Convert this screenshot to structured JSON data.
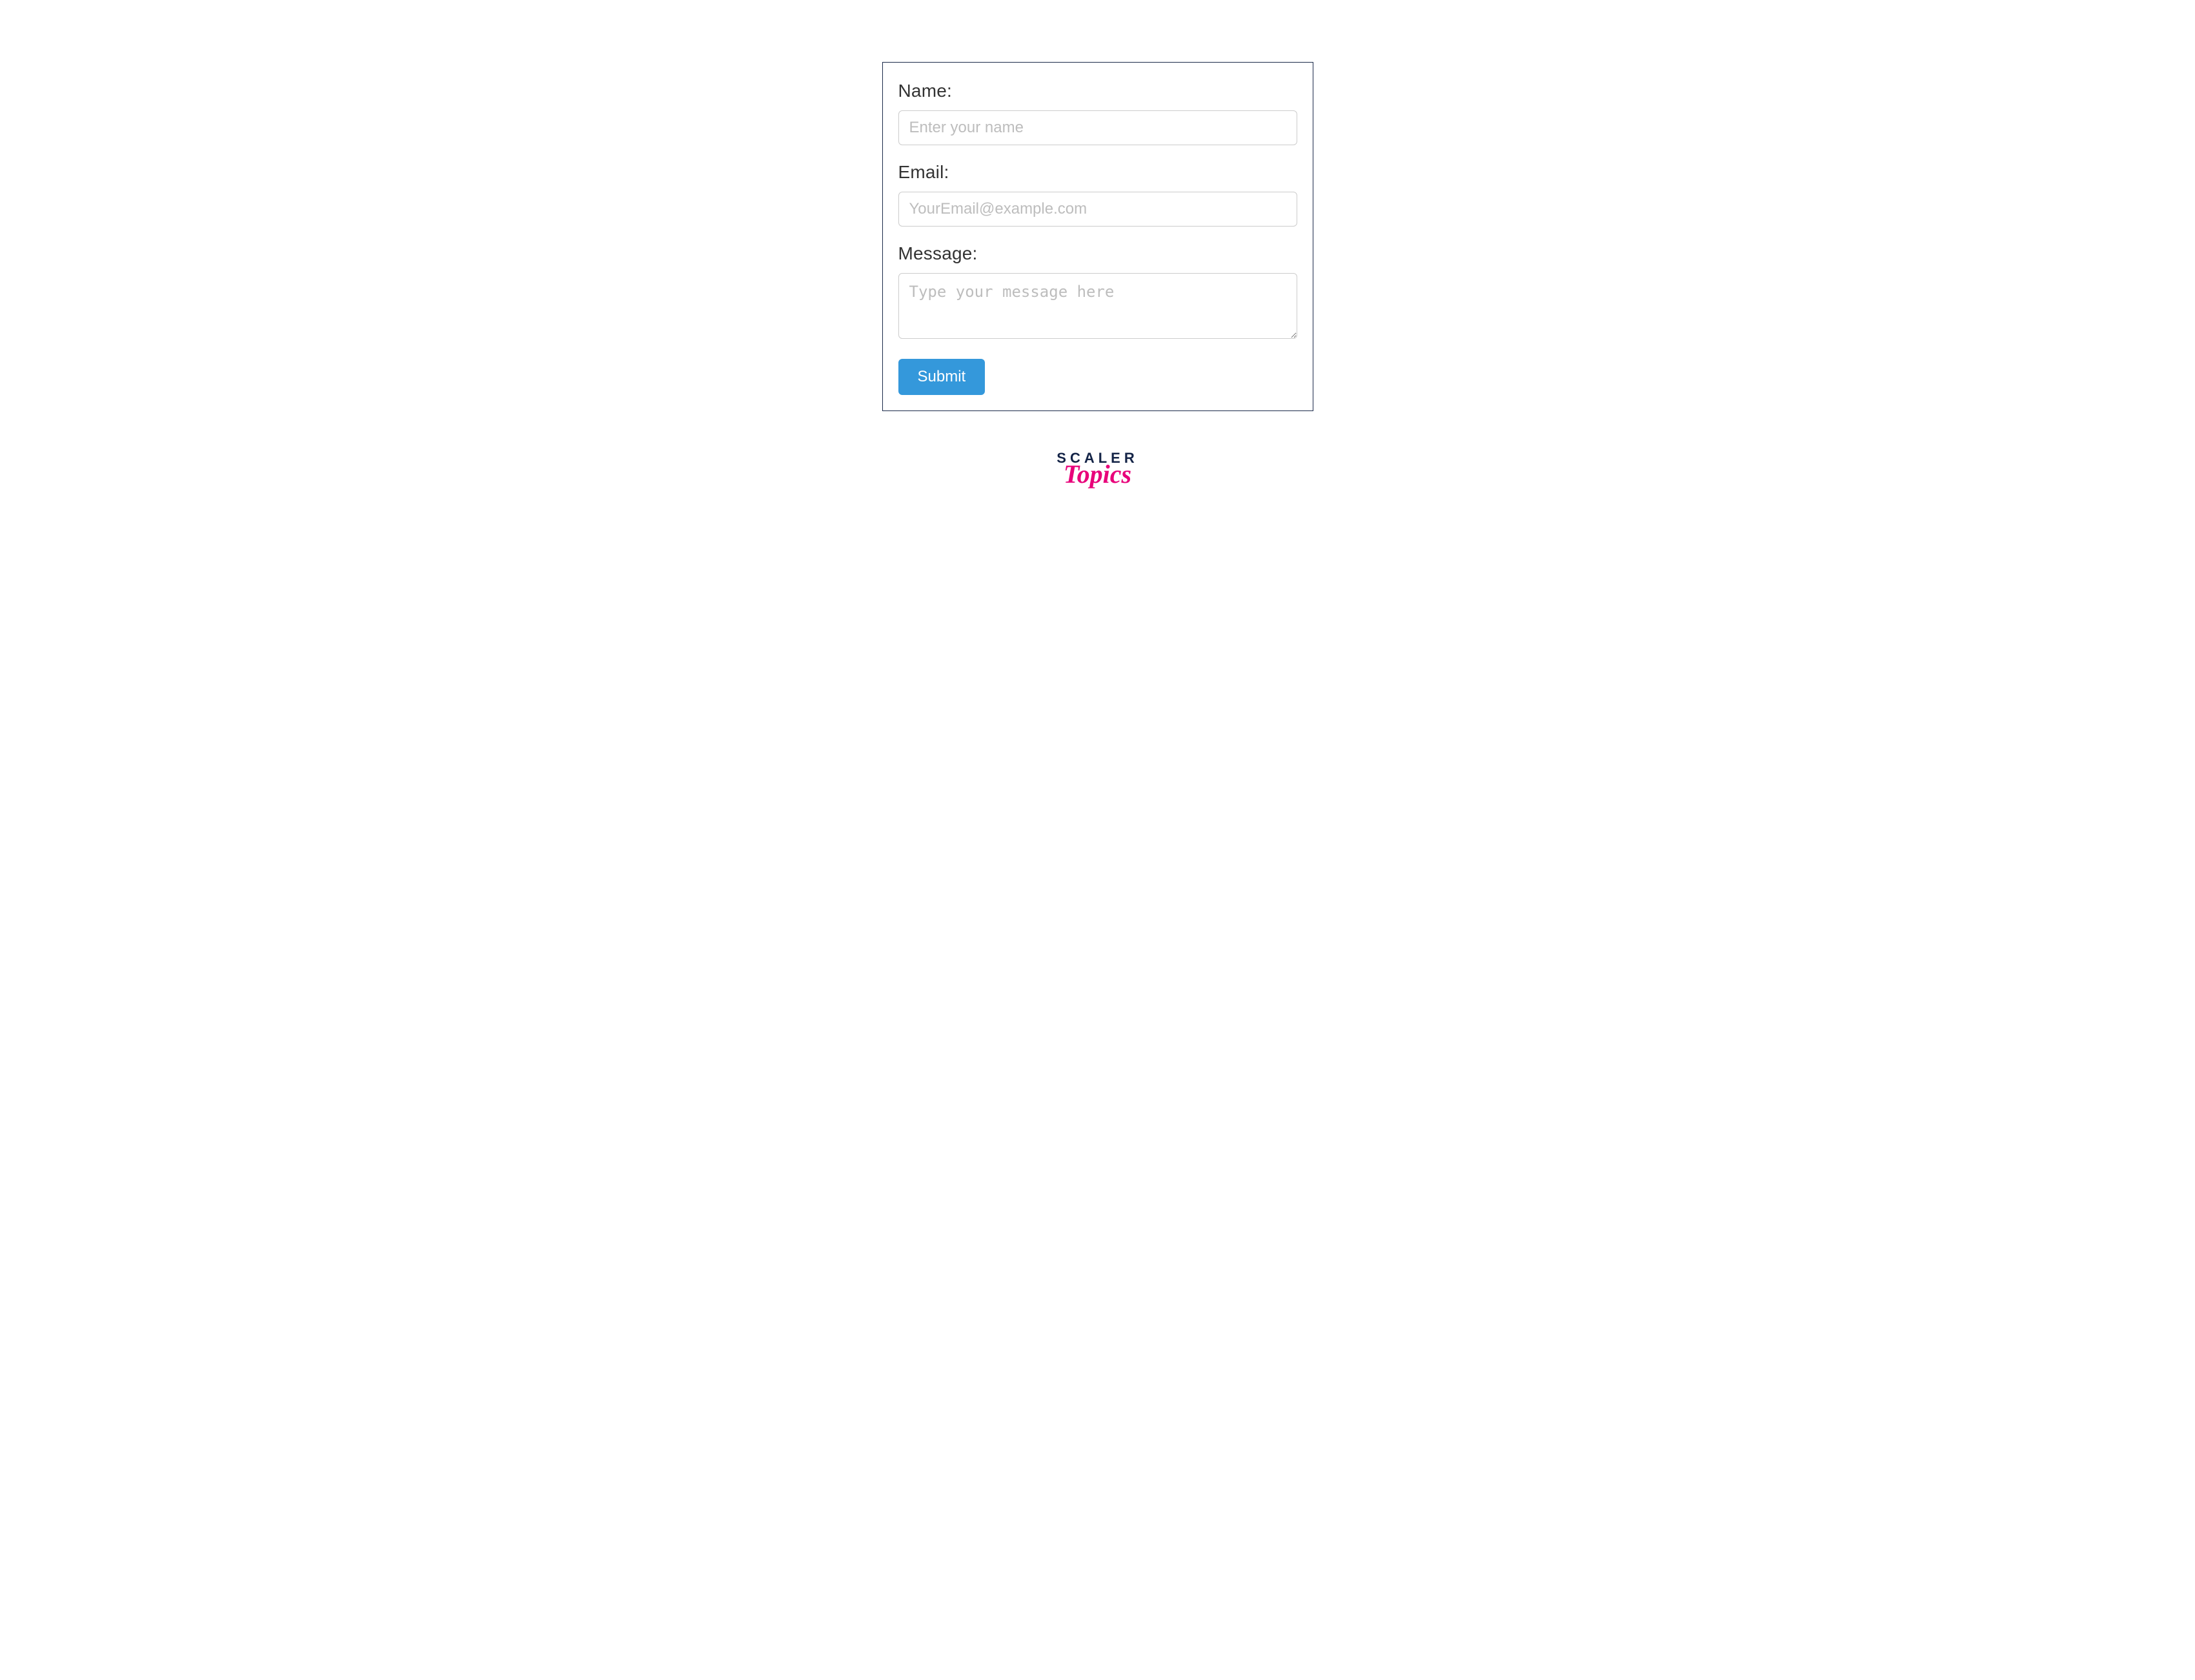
{
  "form": {
    "name": {
      "label": "Name:",
      "placeholder": "Enter your name",
      "value": ""
    },
    "email": {
      "label": "Email:",
      "placeholder": "YourEmail@example.com",
      "value": ""
    },
    "message": {
      "label": "Message:",
      "placeholder": "Type your message here",
      "value": ""
    },
    "submit_label": "Submit"
  },
  "brand": {
    "line1": "SCALER",
    "line2": "Topics"
  }
}
